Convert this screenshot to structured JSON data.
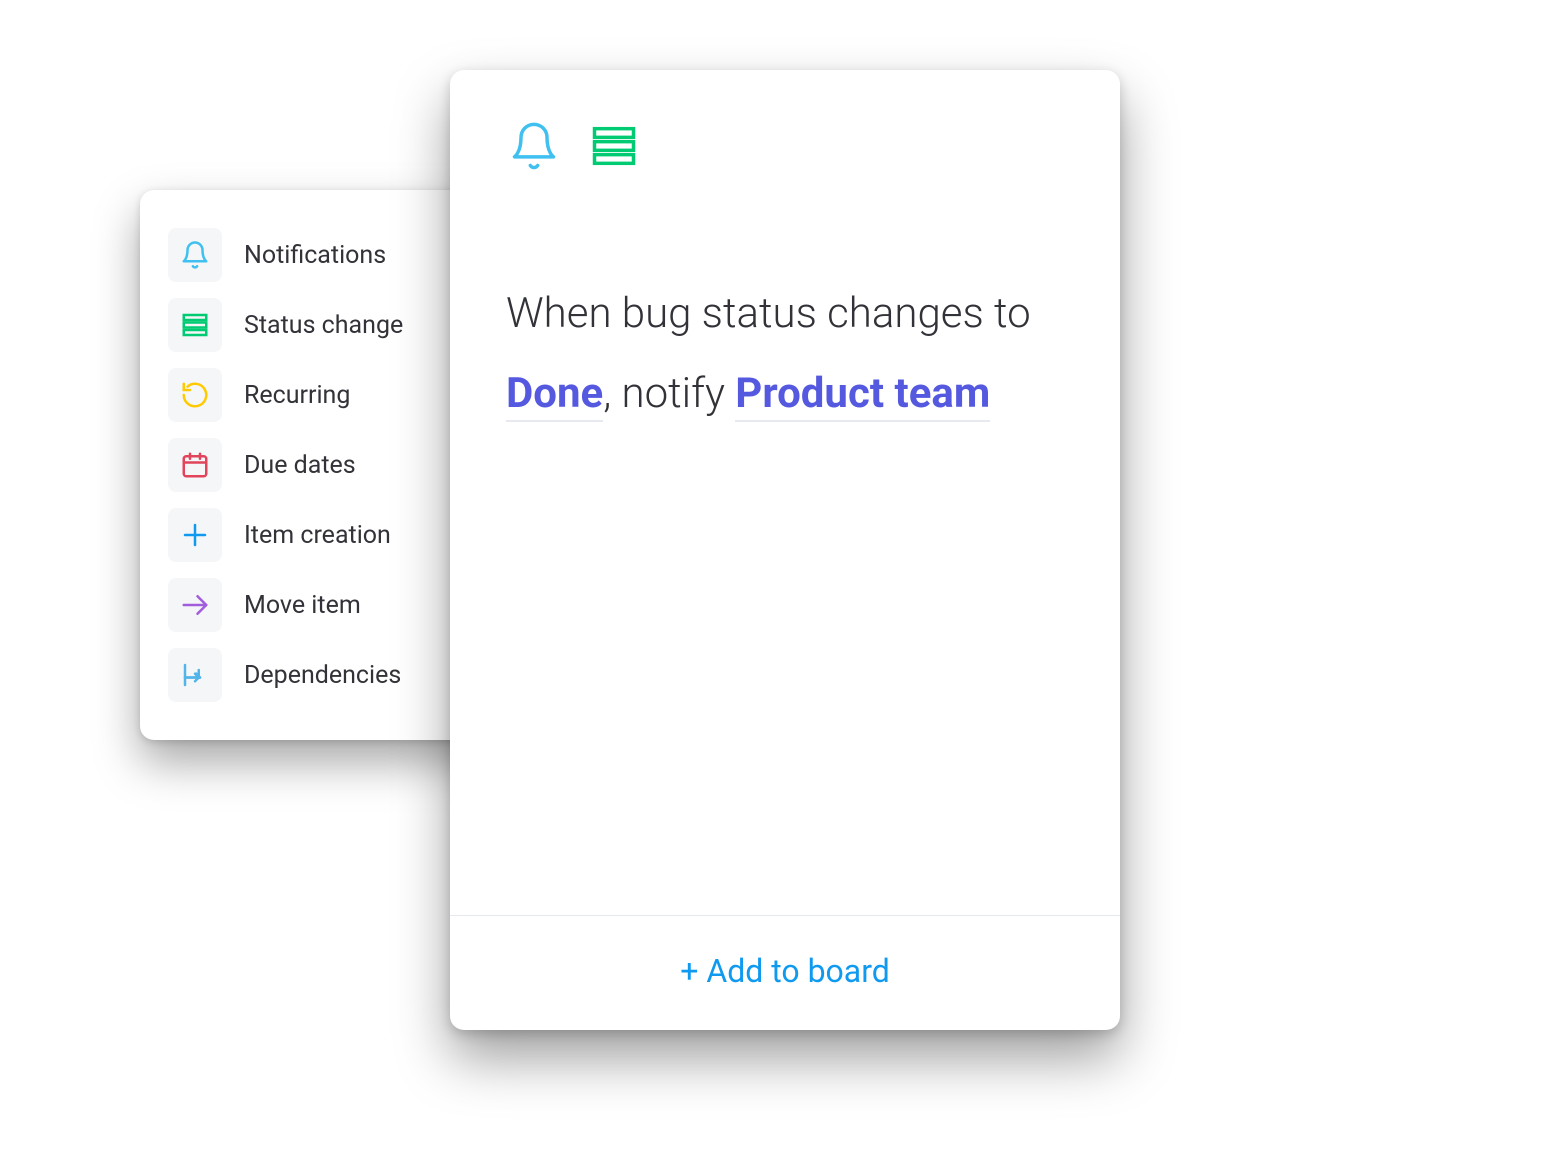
{
  "sidebar": {
    "items": [
      {
        "label": "Notifications",
        "icon": "bell-icon"
      },
      {
        "label": "Status change",
        "icon": "status-icon"
      },
      {
        "label": "Recurring",
        "icon": "recurring-icon"
      },
      {
        "label": "Due dates",
        "icon": "calendar-icon"
      },
      {
        "label": "Item creation",
        "icon": "plus-icon"
      },
      {
        "label": "Move item",
        "icon": "arrow-right-icon"
      },
      {
        "label": "Dependencies",
        "icon": "dependency-icon"
      }
    ]
  },
  "rule": {
    "header_icons": [
      "bell-icon",
      "status-icon"
    ],
    "sentence": {
      "part1": "When bug status changes to ",
      "kw1": "Done",
      "part2": ", notify ",
      "kw2": "Product team"
    },
    "add_label": "+ Add to board"
  },
  "colors": {
    "bell": "#3fc0f0",
    "status": "#00ca72",
    "recur": "#ffcb00",
    "cal": "#e2445c",
    "plus": "#0f9af0",
    "arrow": "#a25ddc",
    "dep": "#52b4e9",
    "kw": "#5559df",
    "link": "#0f9af0"
  }
}
